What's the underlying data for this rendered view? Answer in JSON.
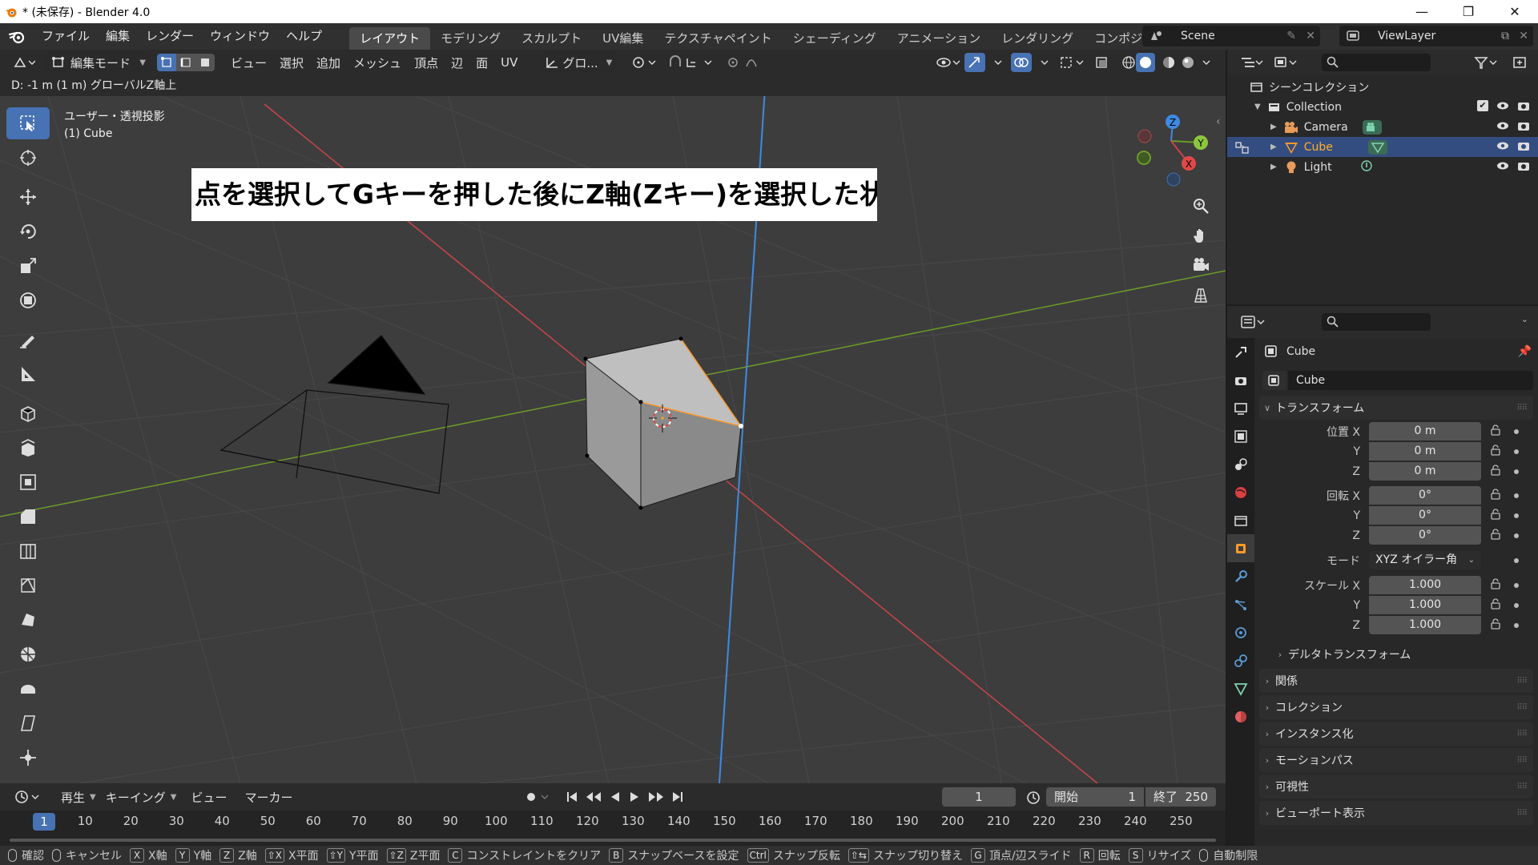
{
  "window": {
    "title": "* (未保存) - Blender 4.0",
    "min": "—",
    "max": "❐",
    "close": "✕"
  },
  "menubar": {
    "menus": [
      "ファイル",
      "編集",
      "レンダー",
      "ウィンドウ",
      "ヘルプ"
    ],
    "workspaces": [
      "レイアウト",
      "モデリング",
      "スカルプト",
      "UV編集",
      "テクスチャペイント",
      "シェーディング",
      "アニメーション",
      "レンダリング",
      "コンポジティング"
    ],
    "active_workspace": "レイアウト",
    "scene": "Scene",
    "view_layer": "ViewLayer"
  },
  "viewport_header": {
    "mode": "編集モード",
    "menus": [
      "ビュー",
      "選択",
      "追加",
      "メッシュ",
      "頂点",
      "辺",
      "面",
      "UV"
    ],
    "orientation": "グロ..."
  },
  "status_line": "D: -1 m (1 m) グローバルZ軸上",
  "viewport": {
    "view_name": "ユーザー・透視投影",
    "object_name": "(1) Cube",
    "annotation": "点を選択してGキーを押した後にZ軸(Zキー)を選択した状態",
    "gizmo": {
      "x": "X",
      "y": "Y",
      "z": "Z"
    },
    "colors": {
      "x_axis": "#c94449",
      "y_axis": "#6b9a2a",
      "z_axis": "#3f8ae0",
      "selected": "#ff9a28"
    }
  },
  "toolbar_tools": [
    "select-box",
    "cursor",
    "move",
    "rotate",
    "scale",
    "transform",
    "annotate",
    "measure",
    "add-cube",
    "extrude",
    "inset",
    "bevel",
    "loop-cut",
    "knife",
    "poly-build",
    "spin",
    "smooth",
    "shear",
    "shrink-fatten"
  ],
  "timeline": {
    "menus": [
      "再生",
      "キーイング",
      "ビュー",
      "マーカー"
    ],
    "current_frame": "1",
    "start_label": "開始",
    "start": "1",
    "end_label": "終了",
    "end": "250",
    "ruler": [
      "10",
      "20",
      "30",
      "40",
      "50",
      "60",
      "70",
      "80",
      "90",
      "100",
      "110",
      "120",
      "130",
      "140",
      "150",
      "160",
      "170",
      "180",
      "190",
      "200",
      "210",
      "220",
      "230",
      "240",
      "250"
    ],
    "ruler_current": "1"
  },
  "statusbar": [
    {
      "key": "",
      "label": "確認"
    },
    {
      "key": "",
      "label": "キャンセル"
    },
    {
      "key": "X",
      "label": "X軸"
    },
    {
      "key": "Y",
      "label": "Y軸"
    },
    {
      "key": "Z",
      "label": "Z軸"
    },
    {
      "key": "⇧X",
      "label": "X平面"
    },
    {
      "key": "⇧Y",
      "label": "Y平面"
    },
    {
      "key": "⇧Z",
      "label": "Z平面"
    },
    {
      "key": "C",
      "label": "コンストレイントをクリア"
    },
    {
      "key": "B",
      "label": "スナップベースを設定"
    },
    {
      "key": "Ctrl",
      "label": "スナップ反転"
    },
    {
      "key": "⇧⇆",
      "label": "スナップ切り替え"
    },
    {
      "key": "G",
      "label": "頂点/辺スライド"
    },
    {
      "key": "R",
      "label": "回転"
    },
    {
      "key": "S",
      "label": "リサイズ"
    },
    {
      "key": "",
      "label": "自動制限"
    }
  ],
  "outliner": {
    "root": "シーンコレクション",
    "collection": "Collection",
    "items": [
      {
        "name": "Camera",
        "selected": false
      },
      {
        "name": "Cube",
        "selected": true
      },
      {
        "name": "Light",
        "selected": false
      }
    ]
  },
  "properties": {
    "object_name": "Cube",
    "datablock": "Cube",
    "transform_title": "トランスフォーム",
    "location": {
      "label": "位置 X",
      "x": "0 m",
      "y": "0 m",
      "z": "0 m"
    },
    "rotation": {
      "label": "回転 X",
      "x": "0°",
      "y": "0°",
      "z": "0°"
    },
    "mode_label": "モード",
    "mode": "XYZ オイラー角",
    "scale": {
      "label": "スケール X",
      "x": "1.000",
      "y": "1.000",
      "z": "1.000"
    },
    "axis_y": "Y",
    "axis_z": "Z",
    "delta": "デルタトランスフォーム",
    "panels": [
      "関係",
      "コレクション",
      "インスタンス化",
      "モーションパス",
      "可視性",
      "ビューポート表示"
    ]
  }
}
